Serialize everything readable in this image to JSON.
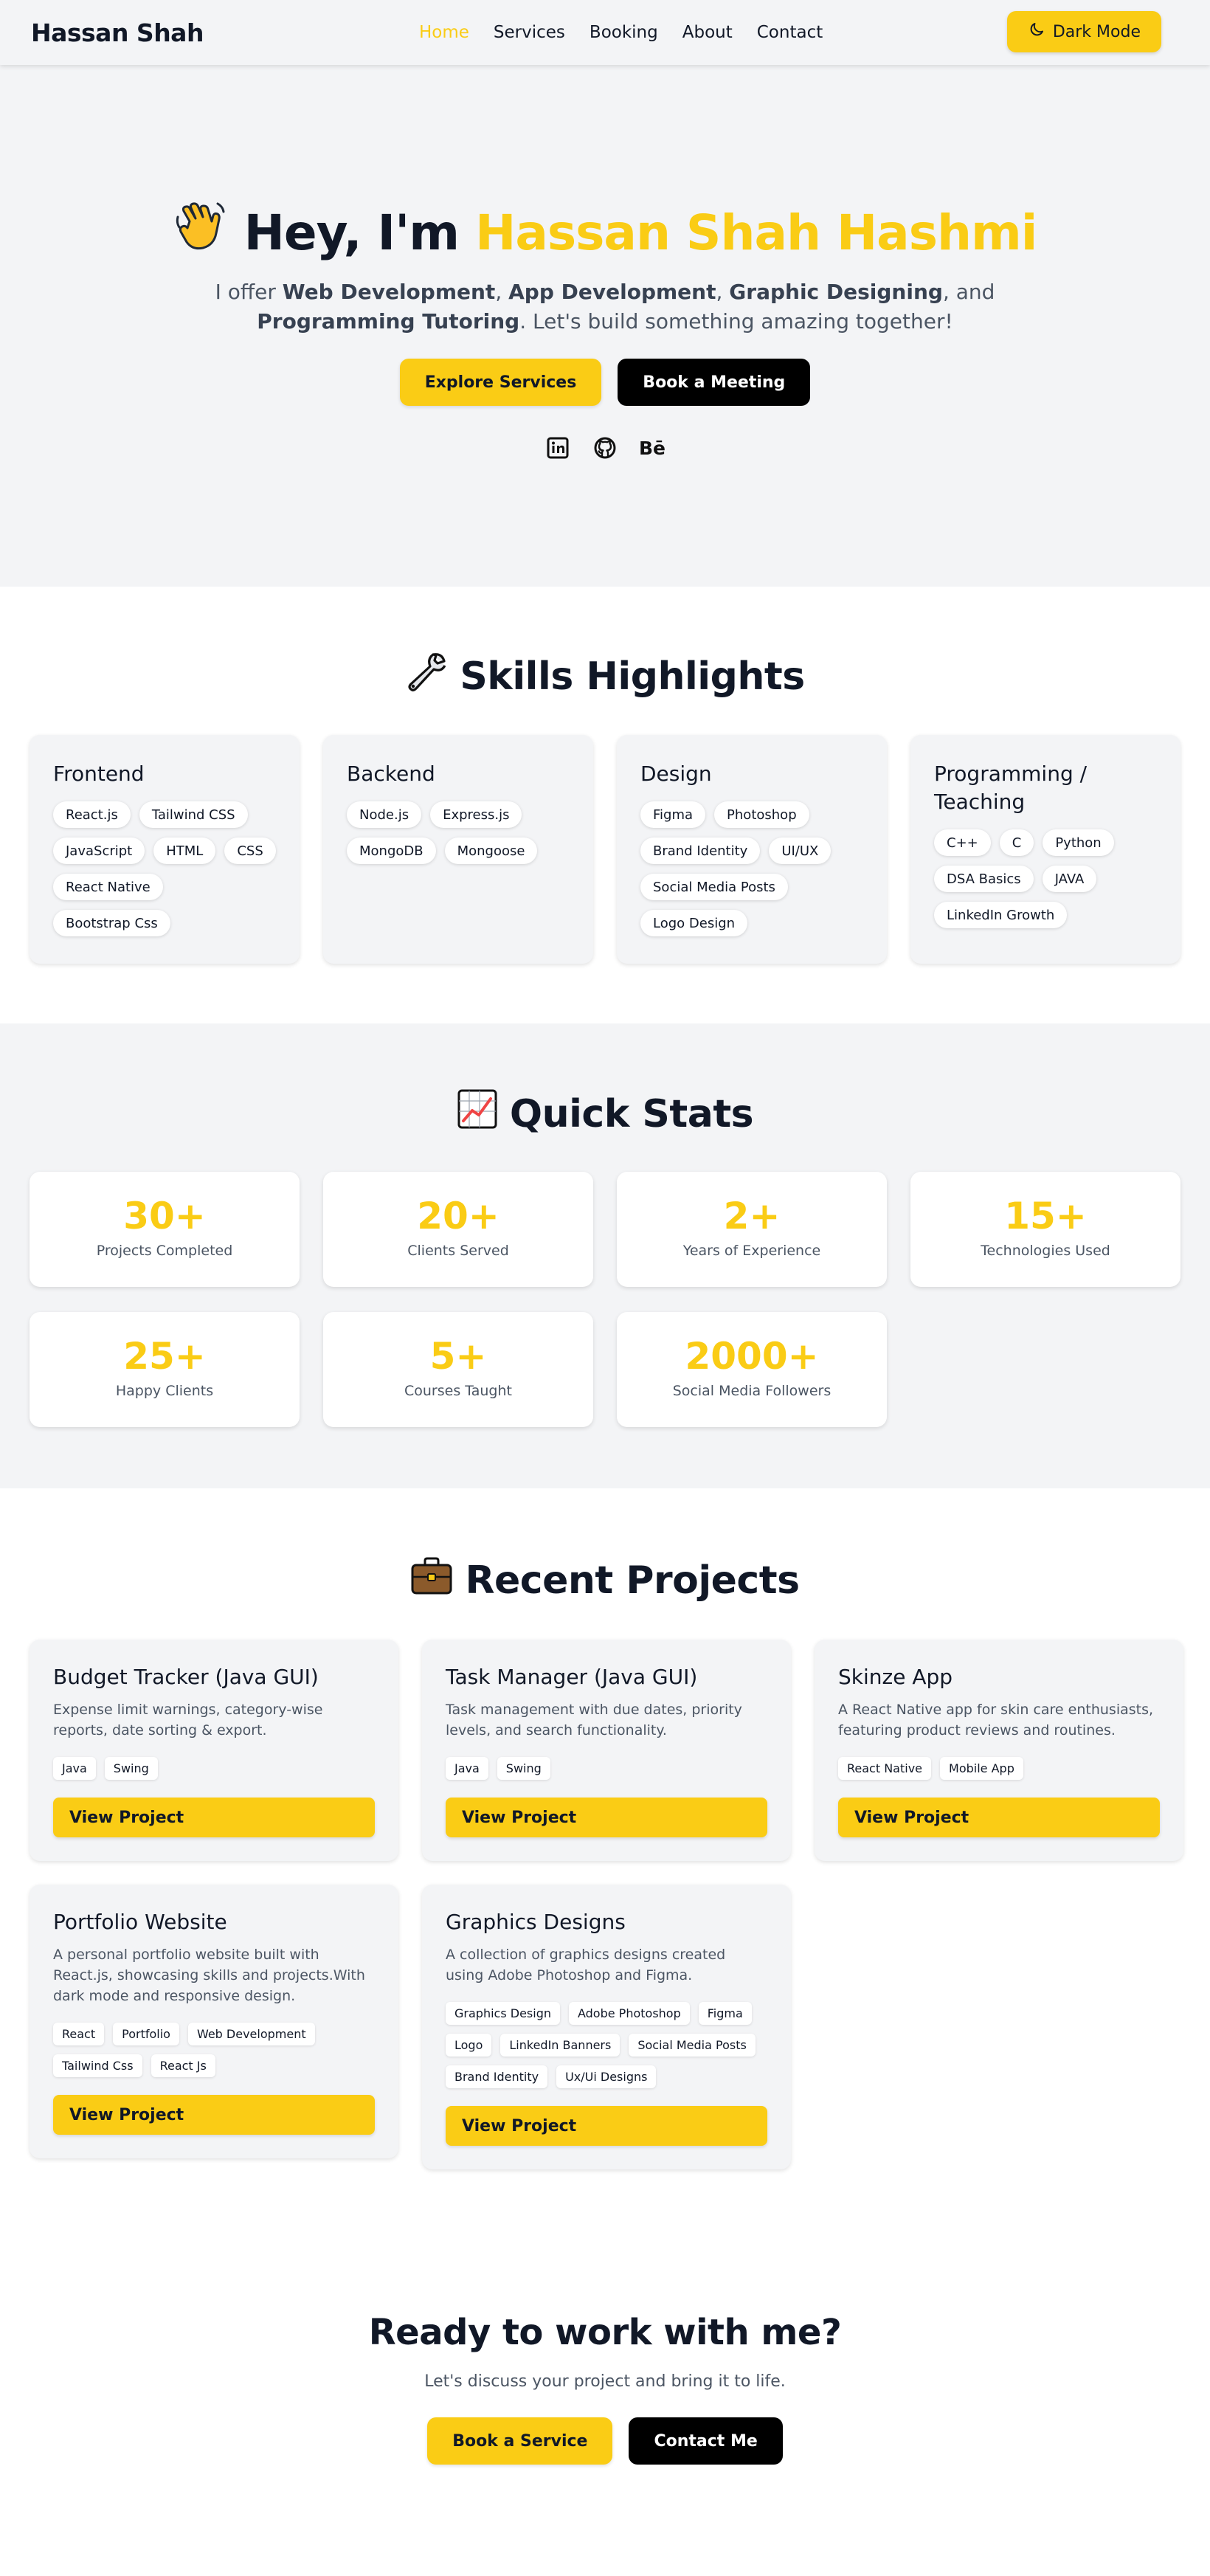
{
  "colors": {
    "accent": "#facc15",
    "dark": "#000000",
    "bg_light": "#f3f4f6"
  },
  "nav": {
    "brand": "Hassan Shah",
    "links": [
      "Home",
      "Services",
      "Booking",
      "About",
      "Contact"
    ],
    "active": "Home",
    "dark_mode_icon": "moon-icon",
    "dark_mode_label": "Dark Mode"
  },
  "hero": {
    "wave_icon": "waving-hand-icon",
    "greeting": "Hey, I'm",
    "name": "Hassan Shah Hashmi",
    "sub": {
      "p1": "I offer ",
      "s1": "Web Development",
      "p2": ", ",
      "s2": "App Development",
      "p3": ", ",
      "s3": "Graphic Designing",
      "p4": ", and ",
      "s4": "Programming Tutoring",
      "p5": ". Let's build something amazing together!"
    },
    "btn_primary": "Explore Services",
    "btn_secondary": "Book a Meeting",
    "socials": [
      "linkedin-icon",
      "github-icon",
      "behance-icon"
    ],
    "behance_text": "Bē"
  },
  "skills": {
    "icon": "wrench-icon",
    "title": "Skills Highlights",
    "cards": [
      {
        "title": "Frontend",
        "items": [
          "React.js",
          "Tailwind CSS",
          "JavaScript",
          "HTML",
          "CSS",
          "React Native",
          "Bootstrap Css"
        ]
      },
      {
        "title": "Backend",
        "items": [
          "Node.js",
          "Express.js",
          "MongoDB",
          "Mongoose"
        ]
      },
      {
        "title": "Design",
        "items": [
          "Figma",
          "Photoshop",
          "Brand Identity",
          "UI/UX",
          "Social Media Posts",
          "Logo Design"
        ]
      },
      {
        "title": "Programming / Teaching",
        "items": [
          "C++",
          "C",
          "Python",
          "DSA Basics",
          "JAVA",
          "LinkedIn Growth"
        ]
      }
    ]
  },
  "stats": {
    "icon": "chart-increasing-icon",
    "title": "Quick Stats",
    "items": [
      {
        "value": "30+",
        "label": "Projects Completed"
      },
      {
        "value": "20+",
        "label": "Clients Served"
      },
      {
        "value": "2+",
        "label": "Years of Experience"
      },
      {
        "value": "15+",
        "label": "Technologies Used"
      },
      {
        "value": "25+",
        "label": "Happy Clients"
      },
      {
        "value": "5+",
        "label": "Courses Taught"
      },
      {
        "value": "2000+",
        "label": "Social Media Followers"
      }
    ]
  },
  "projects": {
    "icon": "briefcase-icon",
    "title": "Recent Projects",
    "button_label": "View Project",
    "items": [
      {
        "title": "Budget Tracker (Java GUI)",
        "desc": "Expense limit warnings, category-wise reports, date sorting & export.",
        "tags": [
          "Java",
          "Swing"
        ]
      },
      {
        "title": "Task Manager (Java GUI)",
        "desc": "Task management with due dates, priority levels, and search functionality.",
        "tags": [
          "Java",
          "Swing"
        ]
      },
      {
        "title": "Skinze App",
        "desc": "A React Native app for skin care enthusiasts, featuring product reviews and routines.",
        "tags": [
          "React Native",
          "Mobile App"
        ]
      },
      {
        "title": "Portfolio Website",
        "desc": "A personal portfolio website built with React.js, showcasing skills and projects.With dark mode and responsive design.",
        "tags": [
          "React",
          "Portfolio",
          "Web Development",
          "Tailwind Css",
          "React Js"
        ]
      },
      {
        "title": "Graphics Designs",
        "desc": "A collection of graphics designs created using Adobe Photoshop and Figma.",
        "tags": [
          "Graphics Design",
          "Adobe Photoshop",
          "Figma",
          "Logo",
          "LinkedIn Banners",
          "Social Media Posts",
          "Brand Identity",
          "Ux/Ui Designs"
        ]
      }
    ]
  },
  "cta": {
    "title": "Ready to work with me?",
    "sub": "Let's discuss your project and bring it to life.",
    "btn_primary": "Book a Service",
    "btn_secondary": "Contact Me"
  }
}
